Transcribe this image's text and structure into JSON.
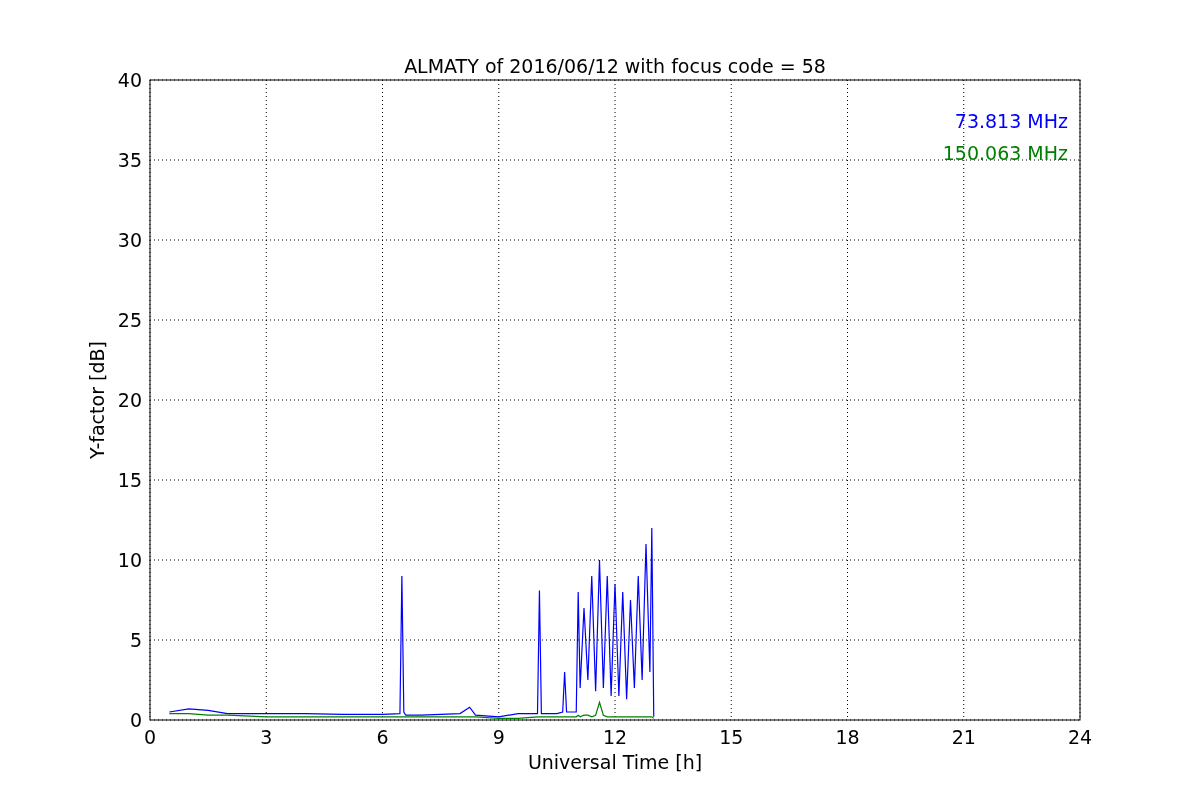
{
  "figure": {
    "chart_data": {
      "type": "line",
      "title": "ALMATY of 2016/06/12 with focus code = 58",
      "xlabel": "Universal Time [h]",
      "ylabel": "Y-factor [dB]",
      "x": [
        0.5,
        1,
        1.5,
        2,
        3,
        4,
        5,
        6,
        6.45,
        6.5,
        6.55,
        6.6,
        7,
        8,
        8.25,
        8.4,
        9,
        9.5,
        10,
        10.05,
        10.1,
        10.5,
        10.65,
        10.7,
        10.75,
        11,
        11.05,
        11.1,
        11.2,
        11.3,
        11.4,
        11.5,
        11.6,
        11.7,
        11.8,
        11.9,
        12,
        12.1,
        12.2,
        12.3,
        12.4,
        12.5,
        12.6,
        12.7,
        12.8,
        12.9,
        12.95,
        13
      ],
      "series": [
        {
          "name": "73.813 MHz",
          "color": "#0000ff",
          "values": [
            0.5,
            0.7,
            0.6,
            0.4,
            0.4,
            0.4,
            0.35,
            0.35,
            0.4,
            9,
            0.5,
            0.3,
            0.3,
            0.4,
            0.8,
            0.3,
            0.2,
            0.4,
            0.4,
            8.1,
            0.4,
            0.4,
            0.5,
            3,
            0.5,
            0.5,
            8,
            2,
            7,
            2.5,
            9,
            1.8,
            10,
            2,
            9,
            1.5,
            8.5,
            1.5,
            8,
            1.3,
            7.5,
            2,
            9,
            2.5,
            11,
            3,
            12,
            0.2
          ]
        },
        {
          "name": "150.063 MHz",
          "color": "#008000",
          "values": [
            0.4,
            0.4,
            0.3,
            0.3,
            0.2,
            0.2,
            0.2,
            0.2,
            0.2,
            0.2,
            0.2,
            0.2,
            0.2,
            0.2,
            0.2,
            0.2,
            0.1,
            0.1,
            0.2,
            0.2,
            0.2,
            0.2,
            0.2,
            0.2,
            0.2,
            0.2,
            0.3,
            0.2,
            0.3,
            0.3,
            0.2,
            0.3,
            1.1,
            0.3,
            0.2,
            0.2,
            0.2,
            0.2,
            0.2,
            0.2,
            0.2,
            0.2,
            0.2,
            0.2,
            0.2,
            0.2,
            0.2,
            0.1
          ]
        }
      ],
      "xlim": [
        0,
        24
      ],
      "ylim": [
        0,
        40
      ],
      "xticks": [
        0,
        3,
        6,
        9,
        12,
        15,
        18,
        21,
        24
      ],
      "yticks": [
        0,
        5,
        10,
        15,
        20,
        25,
        30,
        35,
        40
      ],
      "grid": true
    }
  }
}
